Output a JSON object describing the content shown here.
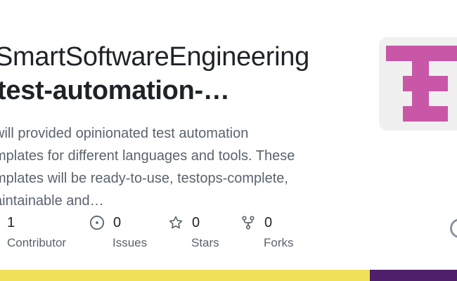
{
  "repo": {
    "owner": "SmartSoftwareEngineering",
    "name": "test-automation-…",
    "description_lines": [
      "will provided opinionated test automation",
      "mplates for different languages and tools. These",
      "mplates will be ready-to-use, testops-complete,",
      "aintainable and…"
    ]
  },
  "stats": {
    "contributors": {
      "value": "1",
      "label": "Contributor",
      "icon": "people-icon"
    },
    "issues": {
      "value": "0",
      "label": "Issues",
      "icon": "issue-opened-icon"
    },
    "stars": {
      "value": "0",
      "label": "Stars",
      "icon": "star-icon"
    },
    "forks": {
      "value": "0",
      "label": "Forks",
      "icon": "repo-forked-icon"
    }
  },
  "logo": {
    "icon": "te-logo-icon",
    "color": "#c957a8",
    "background": "#f0f0f0"
  },
  "footer": {
    "primary_color": "#f1e05a",
    "secondary_color": "#4f1f6b"
  }
}
